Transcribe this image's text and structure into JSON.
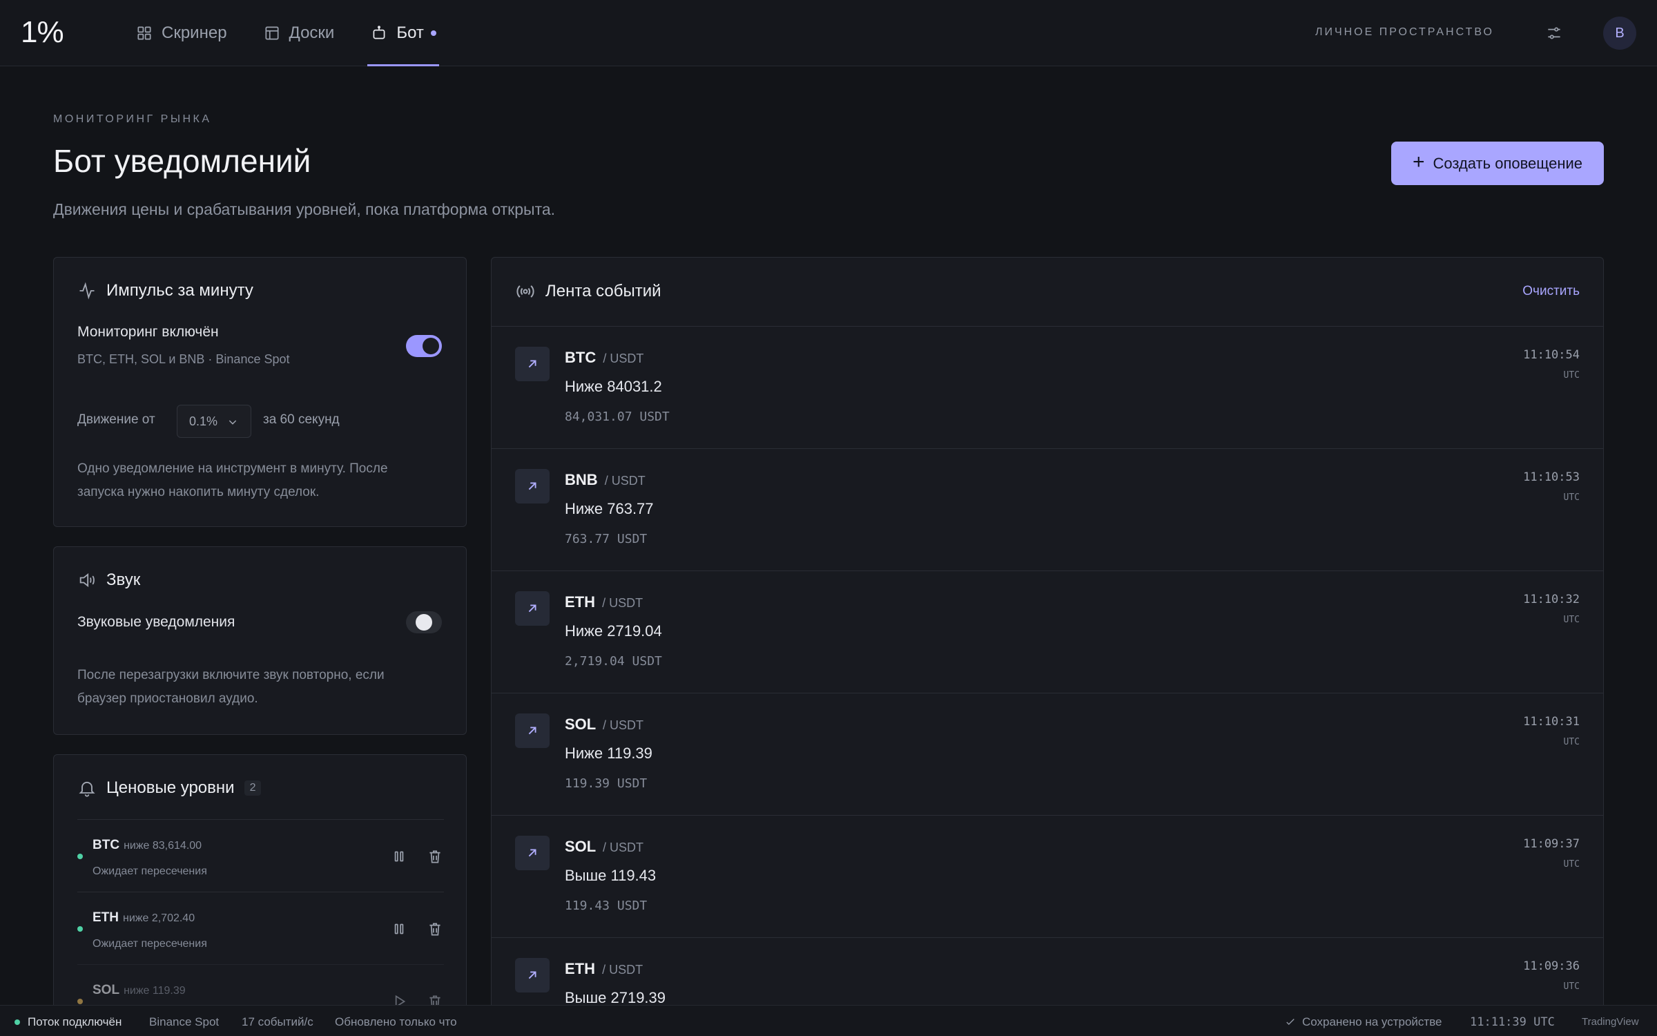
{
  "nav": {
    "logo": "1%",
    "items": [
      {
        "label": "Скринер",
        "icon": "grid-icon"
      },
      {
        "label": "Доски",
        "icon": "layout-icon"
      },
      {
        "label": "Бот",
        "icon": "bot-icon",
        "active": true
      }
    ],
    "workspace": "ЛИЧНОЕ ПРОСТРАНСТВО",
    "avatar": "B"
  },
  "header": {
    "eyebrow": "МОНИТОРИНГ РЫНКА",
    "title": "Бот уведомлений",
    "subtitle": "Движения цены и срабатывания уровней, пока платформа открыта.",
    "create_label": "Создать оповещение"
  },
  "impulse": {
    "title": "Импульс за минуту",
    "monitoring_label": "Мониторинг включён",
    "monitoring_sub": "BTC, ETH, SOL и BNB · Binance Spot",
    "monitoring_on": true,
    "move_from": "Движение от",
    "threshold": "0.1%",
    "window": "за 60 секунд",
    "note": "Одно уведомление на инструмент в минуту. После запуска нужно накопить минуту сделок."
  },
  "sound": {
    "title": "Звук",
    "label": "Звуковые уведомления",
    "enabled": false,
    "note": "После перезагрузки включите звук повторно, если браузер приостановил аудио."
  },
  "levels": {
    "title": "Ценовые уровни",
    "count": "2",
    "items": [
      {
        "symbol": "BTC",
        "condition": "ниже 83,614.00",
        "state": "Ожидает пересечения",
        "status_color": "#4fd1a5",
        "action": "pause"
      },
      {
        "symbol": "ETH",
        "condition": "ниже 2,702.40",
        "state": "Ожидает пересечения",
        "status_color": "#4fd1a5",
        "action": "pause"
      },
      {
        "symbol": "SOL",
        "condition": "ниже 119.39",
        "state": "",
        "status_color": "#e0b35a",
        "action": "play"
      }
    ]
  },
  "feed": {
    "title": "Лента событий",
    "clear_label": "Очистить",
    "events": [
      {
        "symbol": "BTC",
        "quote": "/ USDT",
        "message": "Ниже 84031.2",
        "price": "84,031.07 USDT",
        "time": "11:10:54",
        "tz": "UTC"
      },
      {
        "symbol": "BNB",
        "quote": "/ USDT",
        "message": "Ниже 763.77",
        "price": "763.77 USDT",
        "time": "11:10:53",
        "tz": "UTC"
      },
      {
        "symbol": "ETH",
        "quote": "/ USDT",
        "message": "Ниже 2719.04",
        "price": "2,719.04 USDT",
        "time": "11:10:32",
        "tz": "UTC"
      },
      {
        "symbol": "SOL",
        "quote": "/ USDT",
        "message": "Ниже 119.39",
        "price": "119.39 USDT",
        "time": "11:10:31",
        "tz": "UTC"
      },
      {
        "symbol": "SOL",
        "quote": "/ USDT",
        "message": "Выше 119.43",
        "price": "119.43 USDT",
        "time": "11:09:37",
        "tz": "UTC"
      },
      {
        "symbol": "ETH",
        "quote": "/ USDT",
        "message": "Выше 2719.39",
        "price": "",
        "time": "11:09:36",
        "tz": "UTC"
      }
    ]
  },
  "status": {
    "stream": "Поток подключён",
    "exchange": "Binance Spot",
    "rate": "17 событий/с",
    "updated": "Обновлено только что",
    "saved": "Сохранено на устройстве",
    "clock": "11:11:39 UTC",
    "provider": "TradingView"
  },
  "colors": {
    "accent": "#a9a6ff",
    "ok": "#4fd1a5",
    "warn": "#e0b35a",
    "bg": "#121418"
  }
}
